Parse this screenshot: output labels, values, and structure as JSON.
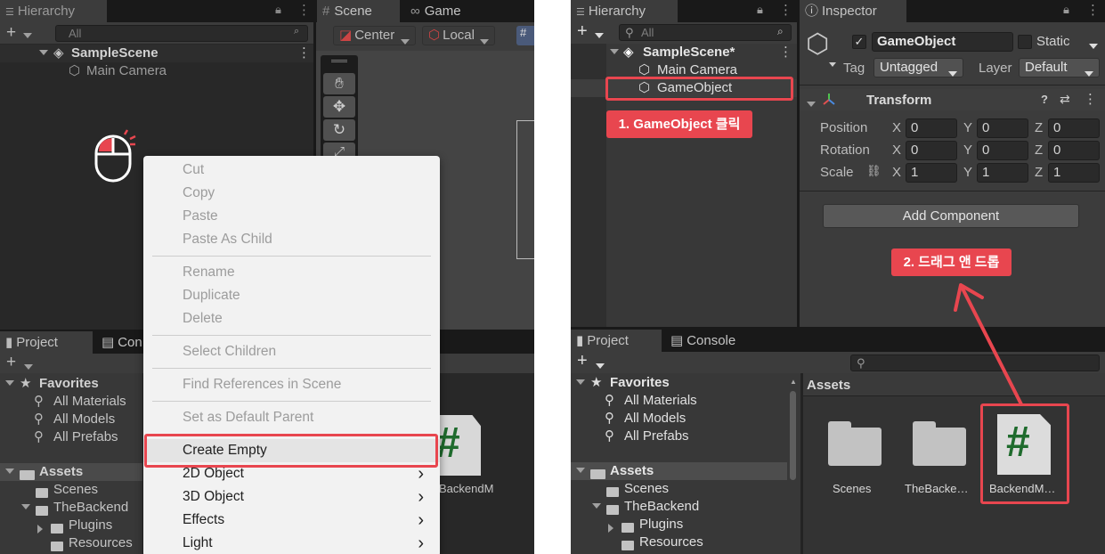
{
  "left": {
    "hierarchy_tab": "Hierarchy",
    "scene_tab": "Scene",
    "game_tab": "Game",
    "search_placeholder": "All",
    "scene_name": "SampleScene",
    "main_camera": "Main Camera",
    "pivot_label": "Center",
    "space_label": "Local",
    "project_tab": "Project",
    "console_tab_partial": "Con",
    "favorites_label": "Favorites",
    "favorites": [
      "All Materials",
      "All Models",
      "All Prefabs"
    ],
    "assets_label": "Assets",
    "folders": [
      "Scenes",
      "TheBackend",
      "Plugins",
      "Resources"
    ],
    "asset_partial_label": "BackendM",
    "script_glyph": "#",
    "context_menu": {
      "items": [
        {
          "label": "Cut",
          "enabled": false
        },
        {
          "label": "Copy",
          "enabled": false
        },
        {
          "label": "Paste",
          "enabled": false
        },
        {
          "label": "Paste As Child",
          "enabled": false
        },
        {
          "label": "Rename",
          "enabled": false
        },
        {
          "label": "Duplicate",
          "enabled": false
        },
        {
          "label": "Delete",
          "enabled": false
        },
        {
          "label": "Select Children",
          "enabled": false
        },
        {
          "label": "Find References in Scene",
          "enabled": false
        },
        {
          "label": "Set as Default Parent",
          "enabled": false
        },
        {
          "label": "Create Empty",
          "enabled": true,
          "highlighted": true
        },
        {
          "label": "2D Object",
          "enabled": true,
          "submenu": true
        },
        {
          "label": "3D Object",
          "enabled": true,
          "submenu": true
        },
        {
          "label": "Effects",
          "enabled": true,
          "submenu": true
        },
        {
          "label": "Light",
          "enabled": true,
          "submenu": true
        }
      ],
      "submenu_glyph": "›"
    }
  },
  "right": {
    "hierarchy_tab": "Hierarchy",
    "inspector_tab": "Inspector",
    "search_placeholder": "All",
    "scene_name": "SampleScene*",
    "main_camera": "Main Camera",
    "game_object": "GameObject",
    "callout_1": "1. GameObject 클릭",
    "callout_2": "2. 드래그 앤 드롭",
    "inspector": {
      "object_name": "GameObject",
      "static_label": "Static",
      "tag_label": "Tag",
      "tag_value": "Untagged",
      "layer_label": "Layer",
      "layer_value": "Default",
      "component_title": "Transform",
      "rows": [
        {
          "label": "Position",
          "x": "0",
          "y": "0",
          "z": "0"
        },
        {
          "label": "Rotation",
          "x": "0",
          "y": "0",
          "z": "0"
        },
        {
          "label": "Scale",
          "x": "1",
          "y": "1",
          "z": "1"
        }
      ],
      "axis_x": "X",
      "axis_y": "Y",
      "axis_z": "Z",
      "add_component": "Add Component"
    },
    "project_tab": "Project",
    "console_tab": "Console",
    "favorites_label": "Favorites",
    "favorites": [
      "All Materials",
      "All Models",
      "All Prefabs"
    ],
    "assets_label": "Assets",
    "assets_header": "Assets",
    "folders": [
      "Scenes",
      "TheBackend",
      "Plugins",
      "Resources"
    ],
    "asset_tiles": [
      "Scenes",
      "TheBacke…",
      "BackendM…"
    ],
    "script_glyph": "#"
  },
  "colors": {
    "accent_red": "#e8464f",
    "panel_bg": "#282828",
    "script_green": "#1f6b2d"
  }
}
